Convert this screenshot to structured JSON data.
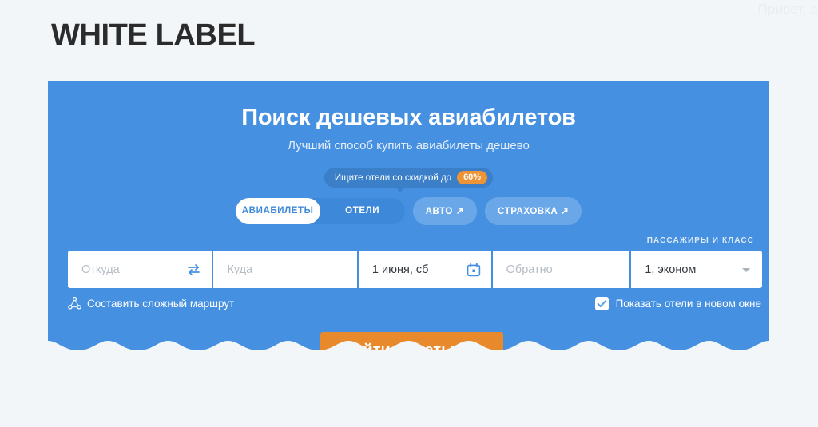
{
  "greeting": "Привет, а",
  "page_title": "WHITE LABEL",
  "widget": {
    "heading": "Поиск дешевых авиабилетов",
    "subheading": "Лучший способ купить авиабилеты дешево",
    "promo": {
      "text": "Ищите отели со скидкой до",
      "discount": "60%"
    },
    "tabs": [
      {
        "label": "АВИАБИЛЕТЫ",
        "active": true,
        "external": false
      },
      {
        "label": "ОТЕЛИ",
        "active": false,
        "external": false
      },
      {
        "label": "АВТО ↗",
        "active": false,
        "external": true
      },
      {
        "label": "СТРАХОВКА ↗",
        "active": false,
        "external": true
      }
    ],
    "passengers_label": "ПАССАЖИРЫ И КЛАСС",
    "fields": {
      "origin": {
        "placeholder": "Откуда",
        "value": ""
      },
      "destination": {
        "placeholder": "Куда",
        "value": ""
      },
      "depart": {
        "placeholder": "",
        "value": "1 июня, сб"
      },
      "return": {
        "placeholder": "Обратно",
        "value": ""
      },
      "passengers": {
        "placeholder": "",
        "value": "1, эконом"
      }
    },
    "icons": {
      "swap": "swap-arrows-icon",
      "calendar": "calendar-icon",
      "multicity": "multi-city-route-icon",
      "plane": "airplane-icon",
      "check": "checkmark-icon",
      "dropdown": "chevron-down-icon"
    },
    "multicity_label": "Составить сложный маршрут",
    "hotels_checkbox": {
      "label": "Показать отели в новом окне",
      "checked": true
    },
    "search_button": "Найти билеты"
  },
  "colors": {
    "panel_blue": "#4590e0",
    "page_bg": "#f2f6f8",
    "accent_orange": "#e8892c",
    "promo_orange": "#ef9435",
    "badge_blue": "#3a7fc8",
    "tab_inactive_blue": "#3d88d8",
    "tab_ext_blue": "#6aa7e8",
    "field_white": "#ffffff",
    "placeholder_grey": "#b6bdc4",
    "value_dark": "#343a40",
    "title_dark": "#2b2b2b"
  }
}
